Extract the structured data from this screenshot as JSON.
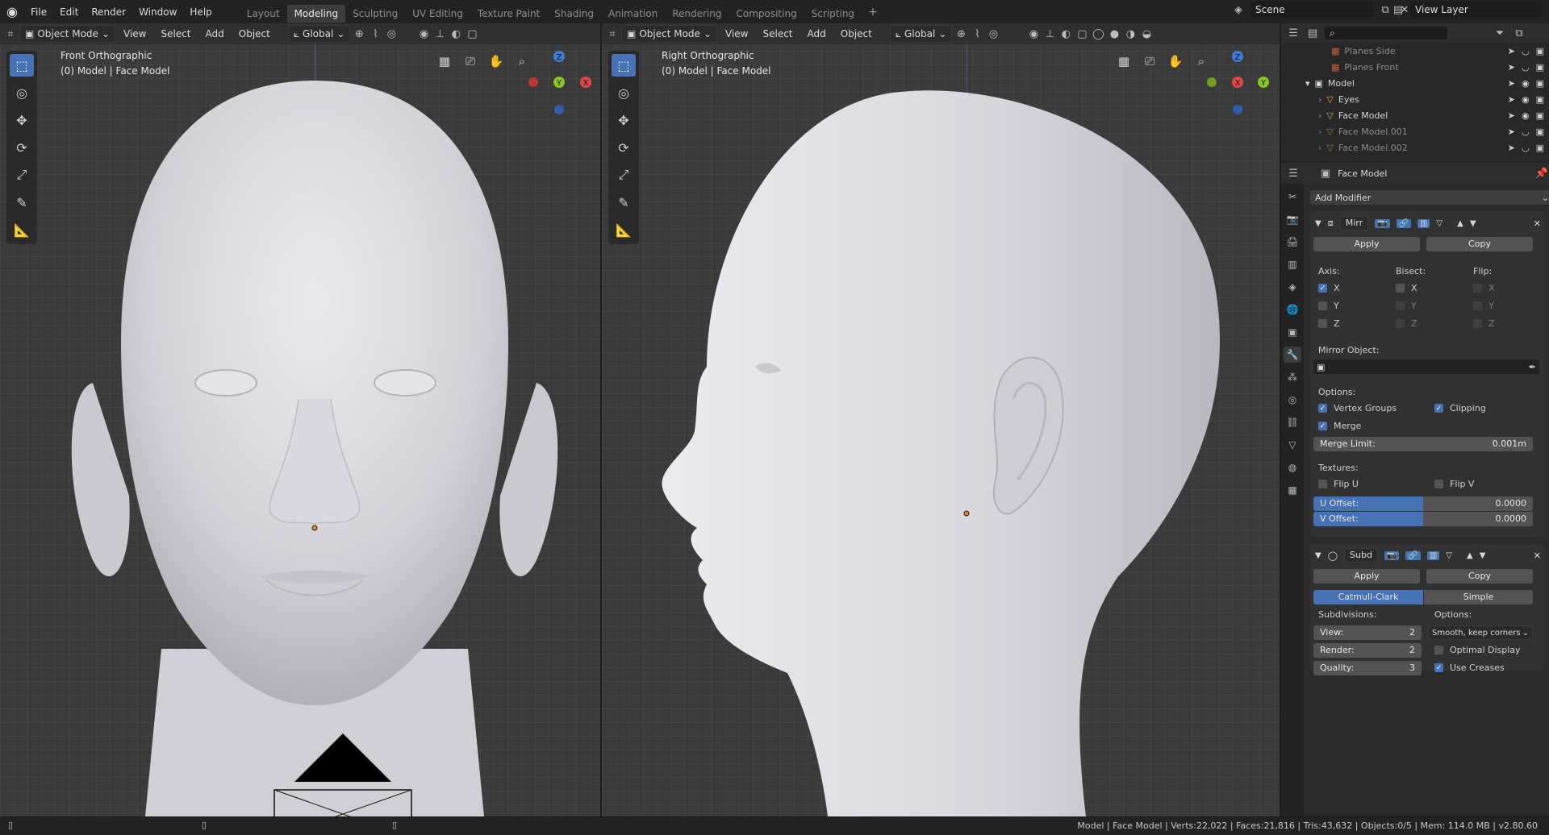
{
  "menu": {
    "items": [
      "File",
      "Edit",
      "Render",
      "Window",
      "Help"
    ]
  },
  "workspaces": {
    "tabs": [
      "Layout",
      "Modeling",
      "Sculpting",
      "UV Editing",
      "Texture Paint",
      "Shading",
      "Animation",
      "Rendering",
      "Compositing",
      "Scripting"
    ],
    "active": "Modeling",
    "add": "+"
  },
  "scene": {
    "name": "Scene",
    "view_layer": "View Layer"
  },
  "left_viewport": {
    "mode": "Object Mode",
    "menus": [
      "View",
      "Select",
      "Add",
      "Object"
    ],
    "orientation": "Global",
    "label": "Front Orthographic",
    "sublabel": "(0) Model | Face Model",
    "gizmo": {
      "z": "Z",
      "y": "Y",
      "x": "X"
    }
  },
  "right_viewport": {
    "mode": "Object Mode",
    "menus": [
      "View",
      "Select",
      "Add",
      "Object"
    ],
    "orientation": "Global",
    "label": "Right Orthographic",
    "sublabel": "(0) Model | Face Model",
    "gizmo": {
      "z": "Z",
      "y": "Y",
      "x": "X"
    }
  },
  "outliner": {
    "rows": [
      {
        "name": "Planes Side",
        "dim": true
      },
      {
        "name": "Planes Front",
        "dim": true
      },
      {
        "name": "Model",
        "dim": false
      },
      {
        "name": "Eyes",
        "dim": false
      },
      {
        "name": "Face Model",
        "dim": false
      },
      {
        "name": "Face Model.001",
        "dim": true
      },
      {
        "name": "Face Model.002",
        "dim": true
      }
    ]
  },
  "properties": {
    "object_name": "Face Model",
    "add_modifier": "Add Modifier",
    "mirror": {
      "name": "Mirr",
      "apply": "Apply",
      "copy": "Copy",
      "axis_label": "Axis:",
      "bisect_label": "Bisect:",
      "flip_label": "Flip:",
      "x": "X",
      "y": "Y",
      "z": "Z",
      "mirror_object": "Mirror Object:",
      "options_label": "Options:",
      "vertex_groups": "Vertex Groups",
      "clipping": "Clipping",
      "merge": "Merge",
      "merge_limit_label": "Merge Limit:",
      "merge_limit_value": "0.001m",
      "textures_label": "Textures:",
      "flip_u": "Flip U",
      "flip_v": "Flip V",
      "u_offset_label": "U Offset:",
      "u_offset_value": "0.0000",
      "v_offset_label": "V Offset:",
      "v_offset_value": "0.0000"
    },
    "subsurf": {
      "name": "Subd",
      "apply": "Apply",
      "copy": "Copy",
      "catmull": "Catmull-Clark",
      "simple": "Simple",
      "subdivisions_label": "Subdivisions:",
      "options_label": "Options:",
      "view_label": "View:",
      "view_value": "2",
      "render_label": "Render:",
      "render_value": "2",
      "quality_label": "Quality:",
      "quality_value": "3",
      "uv_smooth": "Smooth, keep corners",
      "optimal_display": "Optimal Display",
      "use_creases": "Use Creases"
    }
  },
  "status": {
    "text": "Model | Face Model | Verts:22,022 | Faces:21,816 | Tris:43,632 | Objects:0/5 | Mem: 114.0 MB | v2.80.60"
  },
  "colors": {
    "accent": "#4772b3",
    "gizmo_x": "#e04848",
    "gizmo_y": "#8ac525",
    "gizmo_z": "#3d7dd8"
  }
}
